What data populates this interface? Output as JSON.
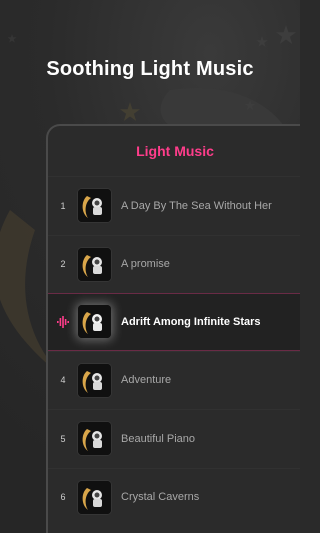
{
  "page": {
    "headline": "Soothing Light Music"
  },
  "phone": {
    "title": "Light Music"
  },
  "tracks": [
    {
      "number": "1",
      "title": "A Day By The Sea Without Her",
      "active": false
    },
    {
      "number": "2",
      "title": "A promise",
      "active": false
    },
    {
      "number": "",
      "title": "Adrift Among Infinite Stars",
      "active": true
    },
    {
      "number": "4",
      "title": "Adventure",
      "active": false
    },
    {
      "number": "5",
      "title": "Beautiful Piano",
      "active": false
    },
    {
      "number": "6",
      "title": "Crystal Caverns",
      "active": false
    }
  ],
  "colors": {
    "accent": "#ff3d8b",
    "background": "#2b2b2b",
    "text": "#ffffff",
    "muted_text": "#a8a8a8"
  },
  "icons": {
    "background_art": "moon-and-stars",
    "now_playing": "soundwave-icon",
    "track_thumbnail": "astronaut-on-moon-icon"
  }
}
